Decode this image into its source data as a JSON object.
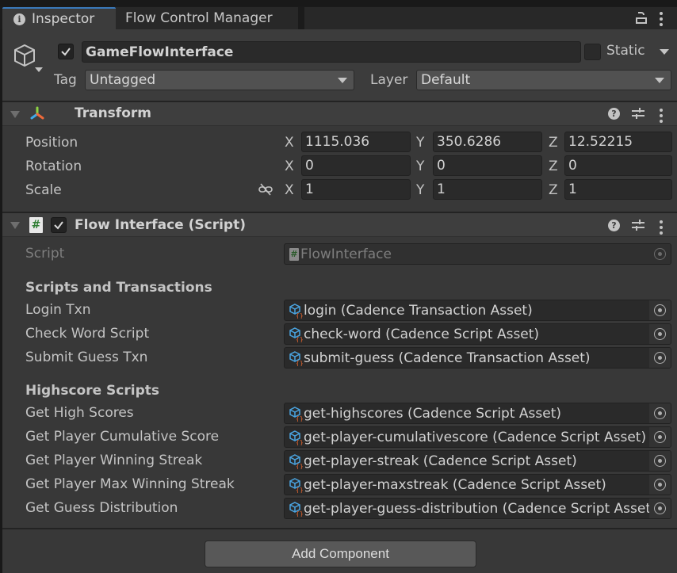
{
  "tabs": [
    {
      "label": "Inspector",
      "icon": "info-icon",
      "active": true
    },
    {
      "label": "Flow Control Manager",
      "active": false
    }
  ],
  "game_object": {
    "active": true,
    "name": "GameFlowInterface",
    "static_label": "Static",
    "static": false,
    "tag_label": "Tag",
    "tag_value": "Untagged",
    "layer_label": "Layer",
    "layer_value": "Default"
  },
  "transform": {
    "title": "Transform",
    "rows": [
      {
        "label": "Position",
        "x": "1115.036",
        "y": "350.6286",
        "z": "12.52215"
      },
      {
        "label": "Rotation",
        "x": "0",
        "y": "0",
        "z": "0"
      },
      {
        "label": "Scale",
        "x": "1",
        "y": "1",
        "z": "1"
      }
    ],
    "axis_labels": {
      "x": "X",
      "y": "Y",
      "z": "Z"
    }
  },
  "flow_interface": {
    "title": "Flow Interface (Script)",
    "enabled": true,
    "script_label": "Script",
    "script_value": "FlowInterface",
    "sections": [
      {
        "header": "Scripts and Transactions",
        "fields": [
          {
            "label": "Login Txn",
            "value": "login (Cadence Transaction Asset)"
          },
          {
            "label": "Check Word Script",
            "value": "check-word (Cadence Script Asset)"
          },
          {
            "label": "Submit Guess Txn",
            "value": "submit-guess (Cadence Transaction Asset)"
          }
        ]
      },
      {
        "header": "Highscore Scripts",
        "fields": [
          {
            "label": "Get High Scores",
            "value": "get-highscores (Cadence Script Asset)"
          },
          {
            "label": "Get Player Cumulative Score",
            "value": "get-player-cumulativescore (Cadence Script Asset)"
          },
          {
            "label": "Get Player Winning Streak",
            "value": "get-player-streak (Cadence Script Asset)"
          },
          {
            "label": "Get Player Max Winning Streak",
            "value": "get-player-maxstreak (Cadence Script Asset)"
          },
          {
            "label": "Get Guess Distribution",
            "value": "get-player-guess-distribution (Cadence Script Asset)"
          }
        ]
      }
    ]
  },
  "add_component_label": "Add Component",
  "colors": {
    "accent_tab": "#3a79bb",
    "panel_bg": "#383838",
    "field_bg": "#2a2a2a"
  }
}
